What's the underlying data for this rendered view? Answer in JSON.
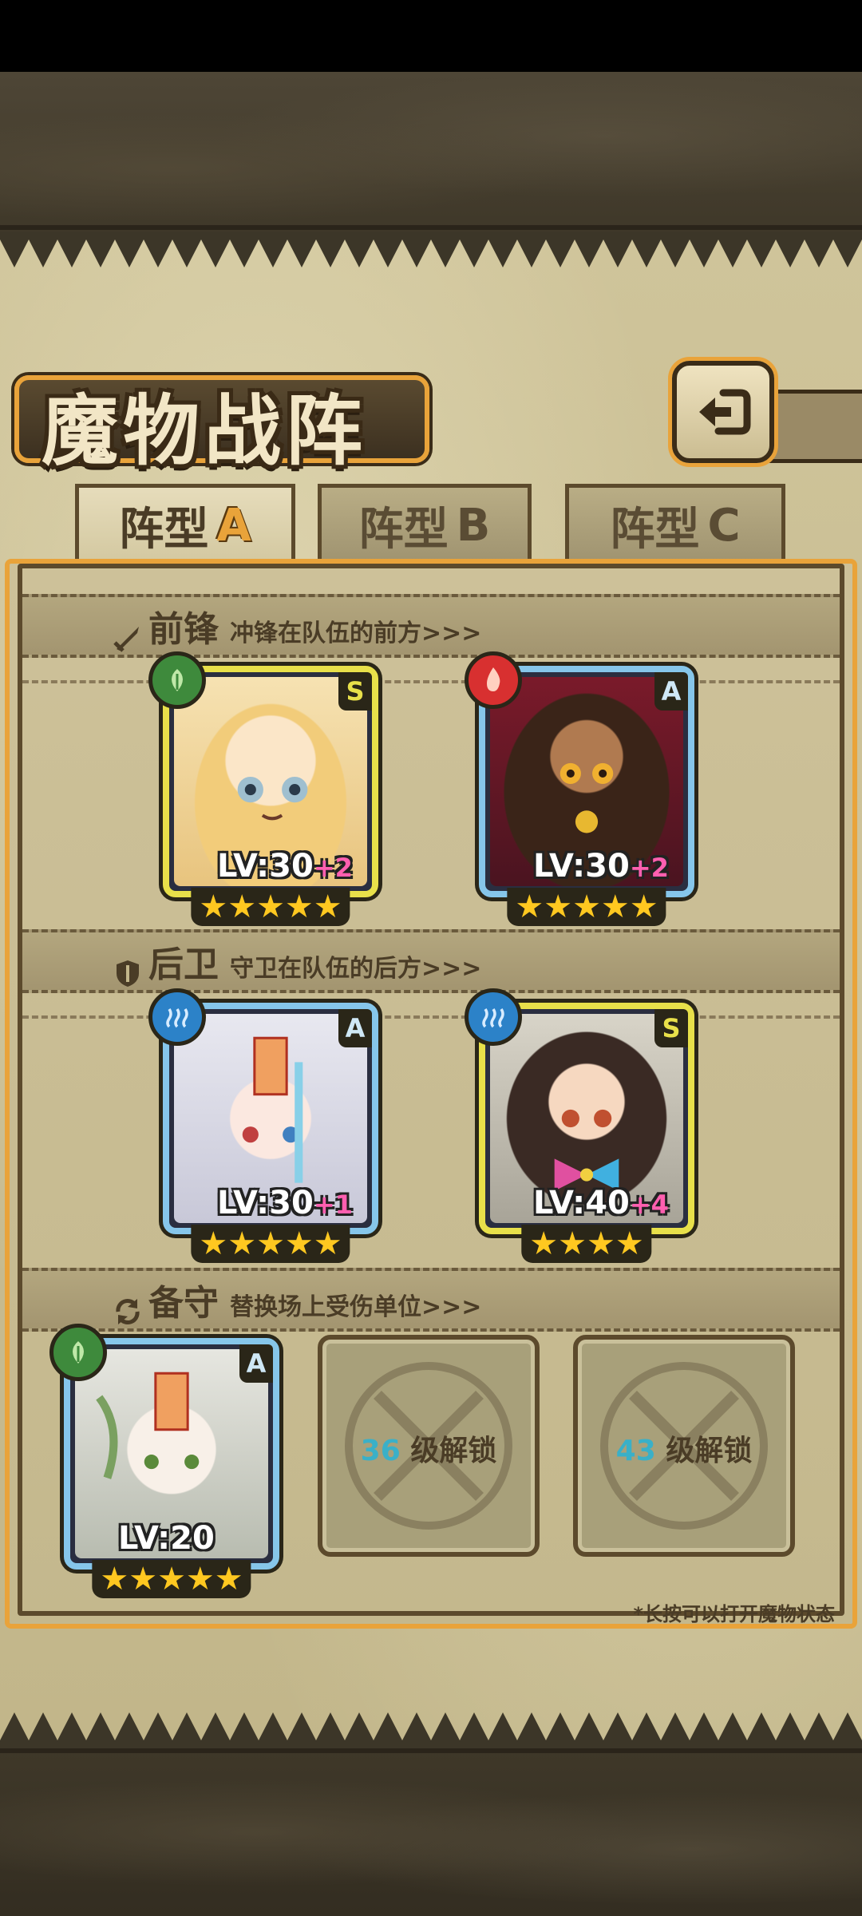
{
  "page_title": "魔物战阵",
  "tabs": [
    {
      "prefix": "阵型",
      "suffix": "A",
      "active": true
    },
    {
      "prefix": "阵型",
      "suffix": "B",
      "active": false
    },
    {
      "prefix": "阵型",
      "suffix": "C",
      "active": false
    }
  ],
  "sections": {
    "front": {
      "title": "前锋",
      "desc": "冲锋在队伍的前方>>>"
    },
    "back": {
      "title": "后卫",
      "desc": "守卫在队伍的后方>>>"
    },
    "reserve": {
      "title": "备守",
      "desc": "替换场上受伤单位>>>"
    }
  },
  "units": {
    "front_1": {
      "rank": "S",
      "element": "nature",
      "lv": "LV:30",
      "bonus": "+2",
      "stars": "★★★★★"
    },
    "front_2": {
      "rank": "A",
      "element": "fire",
      "lv": "LV:30",
      "bonus": "+2",
      "stars": "★★★★★"
    },
    "back_1": {
      "rank": "A",
      "element": "water",
      "lv": "LV:30",
      "bonus": "+1",
      "stars": "★★★★★"
    },
    "back_2": {
      "rank": "S",
      "element": "water",
      "lv": "LV:40",
      "bonus": "+4",
      "stars": "★★★★"
    },
    "reserve_1": {
      "rank": "A",
      "element": "nature",
      "lv": "LV:20",
      "bonus": "",
      "stars": "★★★★★"
    }
  },
  "locked_slots": [
    {
      "level": "36",
      "text": "级解锁"
    },
    {
      "level": "43",
      "text": "级解锁"
    }
  ],
  "hint": "*长按可以打开魔物状态",
  "colors": {
    "accent": "#e9a33a",
    "frame_s": "#e8e04a",
    "frame_a": "#86c6ea",
    "bonus": "#ff5fb0",
    "lock_number": "#3ab0c8"
  }
}
